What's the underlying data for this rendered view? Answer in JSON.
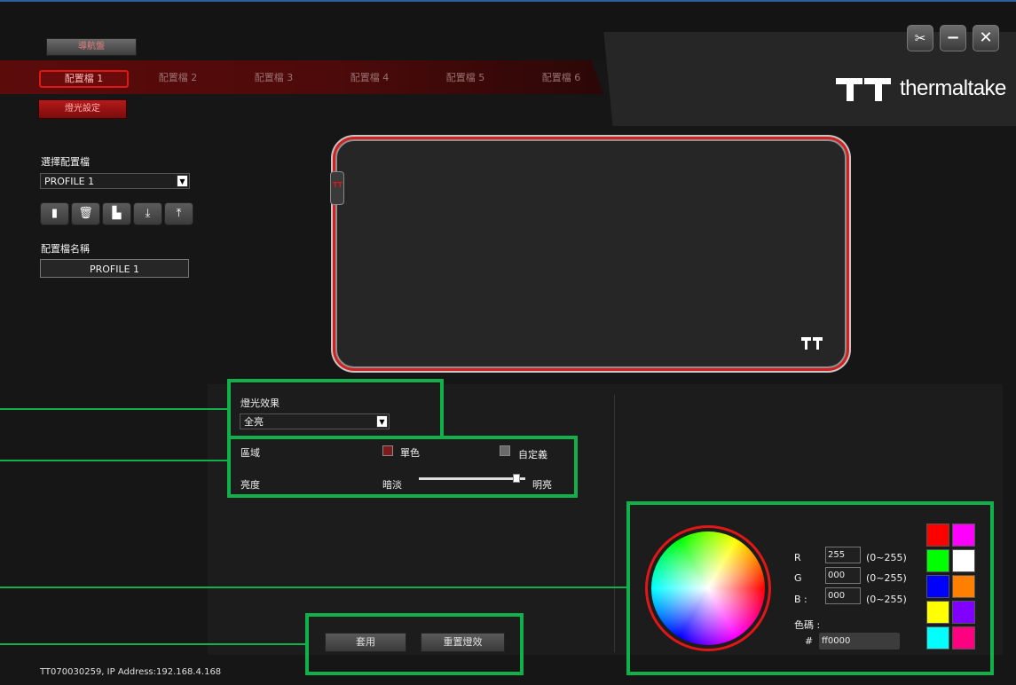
{
  "top": {
    "nav_button": "導航盤",
    "lighting_button": "燈光設定",
    "tabs": [
      "配置檔 1",
      "配置檔 2",
      "配置檔 3",
      "配置檔 4",
      "配置檔 5",
      "配置檔 6"
    ],
    "active_tab": 0,
    "brand": "thermaltake",
    "window_buttons": [
      "tools-icon",
      "minimize-icon",
      "close-icon"
    ]
  },
  "profile": {
    "select_label": "選擇配置檔",
    "selected_profile": "PROFILE 1",
    "toolbar_icons": [
      "save-icon",
      "delete-icon",
      "copy-icon",
      "import-icon",
      "export-icon"
    ],
    "name_label": "配置檔名稱",
    "name_value": "PROFILE 1"
  },
  "effect": {
    "label": "燈光效果",
    "selected": "全亮"
  },
  "zone": {
    "label": "區域",
    "single_color": "單色",
    "custom": "自定義",
    "single_color_swatch": "#7a1c1c",
    "custom_swatch": "#6a6a6a"
  },
  "brightness": {
    "label": "亮度",
    "min_label": "暗淡",
    "max_label": "明亮",
    "level": 0.95
  },
  "color": {
    "r_label": "R",
    "g_label": "G",
    "b_label": "B :",
    "r": "255",
    "g": "000",
    "b": "000",
    "range": "(0~255)",
    "code_label": "色碼 :",
    "hash": "#",
    "hex": "ff0000",
    "palette": [
      "#ff0000",
      "#ff00ff",
      "#00ff00",
      "#ffffff",
      "#0000ff",
      "#ff8000",
      "#ffff00",
      "#8000ff",
      "#00ffff",
      "#ff0080"
    ]
  },
  "actions": {
    "apply": "套用",
    "reset": "重置燈效"
  },
  "footer": "TT070030259, IP Address:192.168.4.168"
}
